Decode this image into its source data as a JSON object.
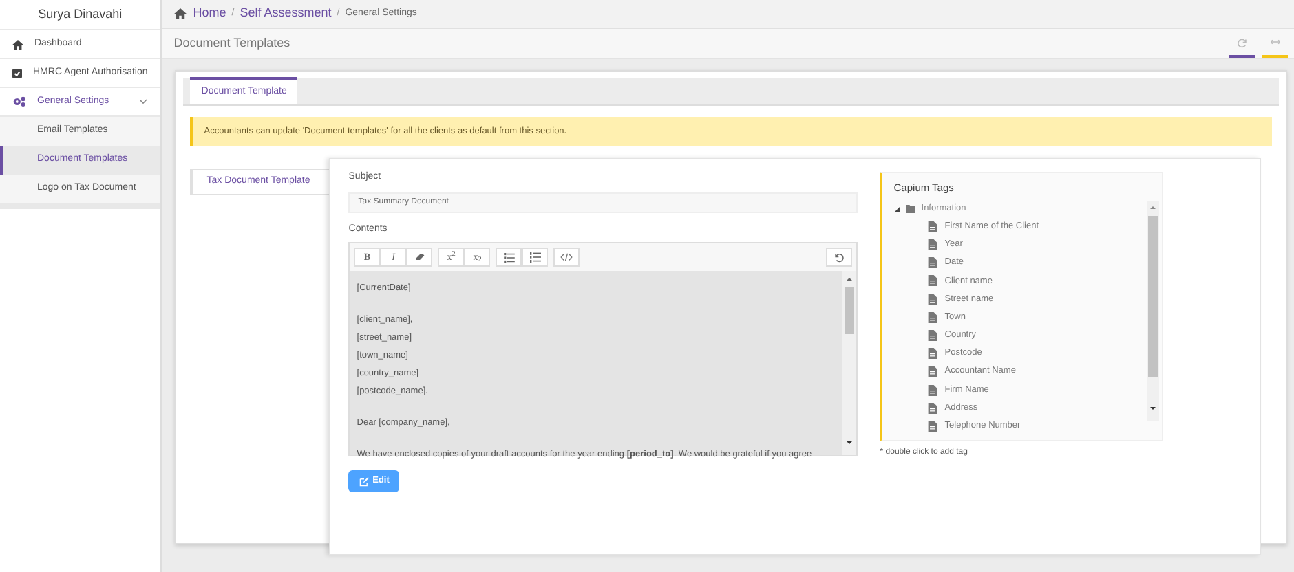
{
  "user": {
    "name": "Surya Dinavahi"
  },
  "sidebar": {
    "items": [
      {
        "label": "Dashboard",
        "kind": "home",
        "selected": false
      },
      {
        "label": "HMRC Agent Authorisation",
        "kind": "check",
        "selected": false
      },
      {
        "label": "General Settings",
        "kind": "gears",
        "selected": false,
        "expanded": true,
        "children": [
          {
            "label": "Email Templates",
            "selected": false
          },
          {
            "label": "Document Templates",
            "selected": true
          },
          {
            "label": "Logo on Tax Document",
            "selected": false
          }
        ]
      }
    ]
  },
  "breadcrumb": [
    {
      "label": "Home"
    },
    {
      "separator": "/",
      "label": "Self Assessment"
    },
    {
      "separator": "/",
      "label": "General Settings"
    }
  ],
  "page_title": "Document Templates",
  "tabs": [
    {
      "label": "Document Template",
      "selected": true
    }
  ],
  "notice": "Accountants can update 'Document templates' for all the clients as default from this section.",
  "side_tabs": [
    {
      "label": "Tax Document Template",
      "selected": true
    }
  ],
  "subject": {
    "label": "Subject",
    "value": "Tax Summary Document"
  },
  "contents": {
    "label": "Contents",
    "toolbar": [
      [
        {
          "kind": "bold",
          "label": "B"
        },
        {
          "kind": "italic",
          "label": "I"
        },
        {
          "kind": "eraser"
        }
      ],
      [
        {
          "kind": "text",
          "label": "x$^{2}$"
        },
        {
          "kind": "text",
          "label": "x$_{2}$"
        }
      ],
      [
        {
          "kind": "bullets"
        },
        {
          "kind": "numbers"
        }
      ],
      [
        {
          "kind": "code"
        }
      ]
    ],
    "paragraphs": [
      [
        "[CurrentDate]"
      ],
      [
        "[client_name],",
        "[street_name]",
        "[town_name]",
        "[country_name]",
        "[postcode_name]."
      ],
      [
        "Dear [company_name],"
      ],
      [
        "We have enclosed copies of your draft accounts for the year ending **[period_to]**. We would be grateful if you agree"
      ]
    ]
  },
  "edit_button": "Edit",
  "tags": {
    "title": "Capium Tags",
    "folder": {
      "label": "Information",
      "expanded": true,
      "children": [
        "First Name of the Client",
        "Year",
        "Date",
        "Client name",
        "Street name",
        "Town",
        "Country",
        "Postcode",
        "Accountant Name",
        "Firm Name",
        "Address",
        "Telephone Number"
      ]
    },
    "hint": "* double click to add tag"
  }
}
